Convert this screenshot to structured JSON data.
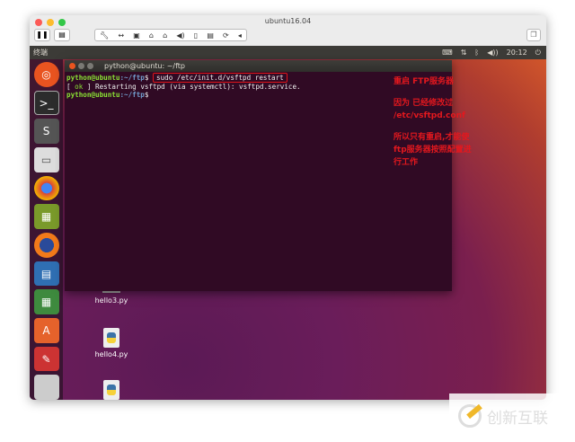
{
  "window": {
    "title": "ubuntu16.04",
    "toolbar_icons": [
      "wrench-icon",
      "arrows-icon",
      "disk-icon",
      "hdd-icon",
      "hdd2-icon",
      "speaker-icon",
      "usb-icon",
      "save-icon",
      "sync-icon",
      "chevron-left-icon"
    ]
  },
  "topbar": {
    "app": "终端",
    "time": "20:12"
  },
  "terminal": {
    "title": "python@ubuntu: ~/ftp",
    "prompt_user": "python@ubuntu",
    "prompt_path": ":~/ftp",
    "command": "sudo /etc/init.d/vsftpd restart",
    "ok": "ok",
    "output": "Restarting vsftpd (via systemctl): vsftpd.service."
  },
  "notes": [
    "重启 FTP服务器",
    "因为 已经修改过 /etc/vsftpd.conf",
    "所以只有重启,才能使ftp服务器按照配置进行工作"
  ],
  "desktop": {
    "files": [
      "hello3.py",
      "hello4.py"
    ]
  },
  "watermark": "创新互联"
}
